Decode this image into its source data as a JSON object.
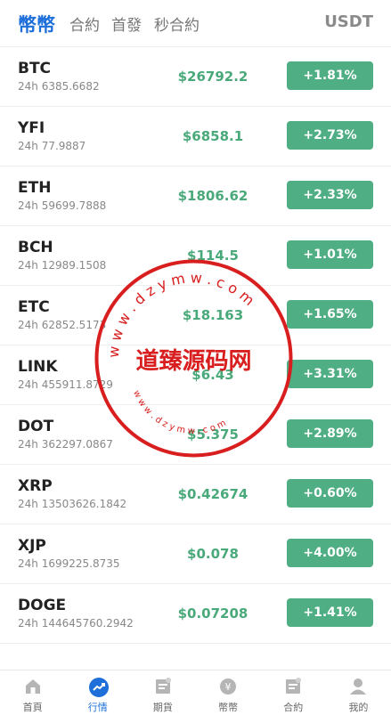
{
  "header": {
    "tabs": [
      "幣幣",
      "合約",
      "首發",
      "秒合約"
    ],
    "active_tab": 0,
    "quote_currency": "USDT"
  },
  "colors": {
    "accent": "#1e6fd9",
    "up": "#4fae83",
    "price_up": "#4aa97a",
    "watermark": "#d81e1e"
  },
  "markets": [
    {
      "symbol": "BTC",
      "volume": "24h 6385.6682",
      "price": "$26792.2",
      "change": "+1.81%"
    },
    {
      "symbol": "YFI",
      "volume": "24h 77.9887",
      "price": "$6858.1",
      "change": "+2.73%"
    },
    {
      "symbol": "ETH",
      "volume": "24h 59699.7888",
      "price": "$1806.62",
      "change": "+2.33%"
    },
    {
      "symbol": "BCH",
      "volume": "24h 12989.1508",
      "price": "$114.5",
      "change": "+1.01%"
    },
    {
      "symbol": "ETC",
      "volume": "24h 62852.5173",
      "price": "$18.163",
      "change": "+1.65%"
    },
    {
      "symbol": "LINK",
      "volume": "24h 455911.8729",
      "price": "$6.43",
      "change": "+3.31%"
    },
    {
      "symbol": "DOT",
      "volume": "24h 362297.0867",
      "price": "$5.375",
      "change": "+2.89%"
    },
    {
      "symbol": "XRP",
      "volume": "24h 13503626.1842",
      "price": "$0.42674",
      "change": "+0.60%"
    },
    {
      "symbol": "XJP",
      "volume": "24h 1699225.8735",
      "price": "$0.078",
      "change": "+4.00%"
    },
    {
      "symbol": "DOGE",
      "volume": "24h 144645760.2942",
      "price": "$0.07208",
      "change": "+1.41%"
    }
  ],
  "bottom_nav": [
    {
      "label": "首頁",
      "icon": "home-icon"
    },
    {
      "label": "行情",
      "icon": "trend-icon"
    },
    {
      "label": "期貨",
      "icon": "futures-icon"
    },
    {
      "label": "幣幣",
      "icon": "coin-icon"
    },
    {
      "label": "合約",
      "icon": "contract-icon"
    },
    {
      "label": "我的",
      "icon": "user-icon"
    }
  ],
  "active_nav": 1,
  "watermark": {
    "text": "道臻源码网",
    "url_top": "w w w . d z y m w . c o m",
    "url_bottom": "w w w . d z y m w . c o m"
  }
}
